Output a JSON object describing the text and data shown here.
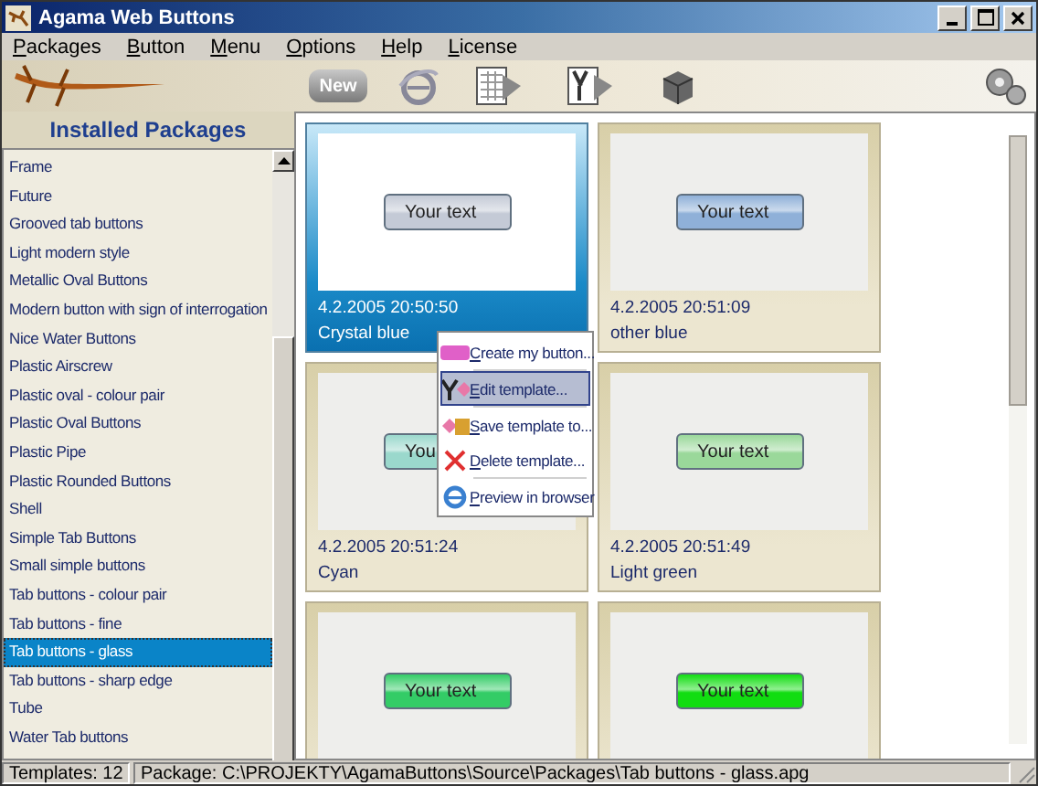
{
  "window": {
    "title": "Agama Web Buttons"
  },
  "menu_bar": [
    "Packages",
    "Button",
    "Menu",
    "Options",
    "Help",
    "License"
  ],
  "toolbar": {
    "new_button": "New"
  },
  "packages": {
    "title": "Installed Packages",
    "items": [
      {
        "label": "Frame",
        "selected": false
      },
      {
        "label": "Future",
        "selected": false
      },
      {
        "label": "Grooved tab buttons",
        "selected": false
      },
      {
        "label": "Light modern style",
        "selected": false
      },
      {
        "label": "Metallic Oval Buttons",
        "selected": false
      },
      {
        "label": "Modern button with sign of interrogation",
        "selected": false
      },
      {
        "label": "Nice Water Buttons",
        "selected": false
      },
      {
        "label": "Plastic Airscrew",
        "selected": false
      },
      {
        "label": "Plastic oval - colour pair",
        "selected": false
      },
      {
        "label": "Plastic Oval Buttons",
        "selected": false
      },
      {
        "label": "Plastic Pipe",
        "selected": false
      },
      {
        "label": "Plastic Rounded Buttons",
        "selected": false
      },
      {
        "label": "Shell",
        "selected": false
      },
      {
        "label": "Simple Tab Buttons",
        "selected": false
      },
      {
        "label": "Small simple buttons",
        "selected": false
      },
      {
        "label": "Tab buttons - colour pair",
        "selected": false
      },
      {
        "label": "Tab buttons - fine",
        "selected": false
      },
      {
        "label": "Tab buttons - glass",
        "selected": true
      },
      {
        "label": "Tab buttons - sharp edge",
        "selected": false
      },
      {
        "label": "Tube",
        "selected": false
      },
      {
        "label": "Water Tab buttons",
        "selected": false
      }
    ]
  },
  "templates": [
    {
      "button_text": "Your text",
      "date": "4.2.2005 20:50:50",
      "name": "Crystal blue",
      "color": "#c4cad6",
      "selected": true
    },
    {
      "button_text": "Your text",
      "date": "4.2.2005 20:51:09",
      "name": "other blue",
      "color": "#8fb0d8",
      "selected": false
    },
    {
      "button_text": "You",
      "date": "4.2.2005 20:51:24",
      "name": "Cyan",
      "color": "#9ad8cc",
      "selected": false
    },
    {
      "button_text": "Your text",
      "date": "4.2.2005 20:51:49",
      "name": "Light green",
      "color": "#9ad89a",
      "selected": false
    },
    {
      "button_text": "Your text",
      "color": "#33cc66",
      "selected": false
    },
    {
      "button_text": "Your text",
      "color": "#11dd11",
      "selected": false
    }
  ],
  "context_menu": [
    {
      "kind": "item",
      "label": "Create my button...",
      "selected": false
    },
    {
      "kind": "separator"
    },
    {
      "kind": "item",
      "label": "Edit template...",
      "selected": true
    },
    {
      "kind": "separator"
    },
    {
      "kind": "item",
      "label": "Save template to...",
      "selected": false
    },
    {
      "kind": "item",
      "label": "Delete template...",
      "selected": false
    },
    {
      "kind": "separator"
    },
    {
      "kind": "item",
      "label": "Preview in browser",
      "selected": false
    }
  ],
  "status_bar": {
    "templates": "Templates: 12",
    "package": "Package: C:\\PROJEKTY\\AgamaButtons\\Source\\Packages\\Tab buttons - glass.apg"
  }
}
